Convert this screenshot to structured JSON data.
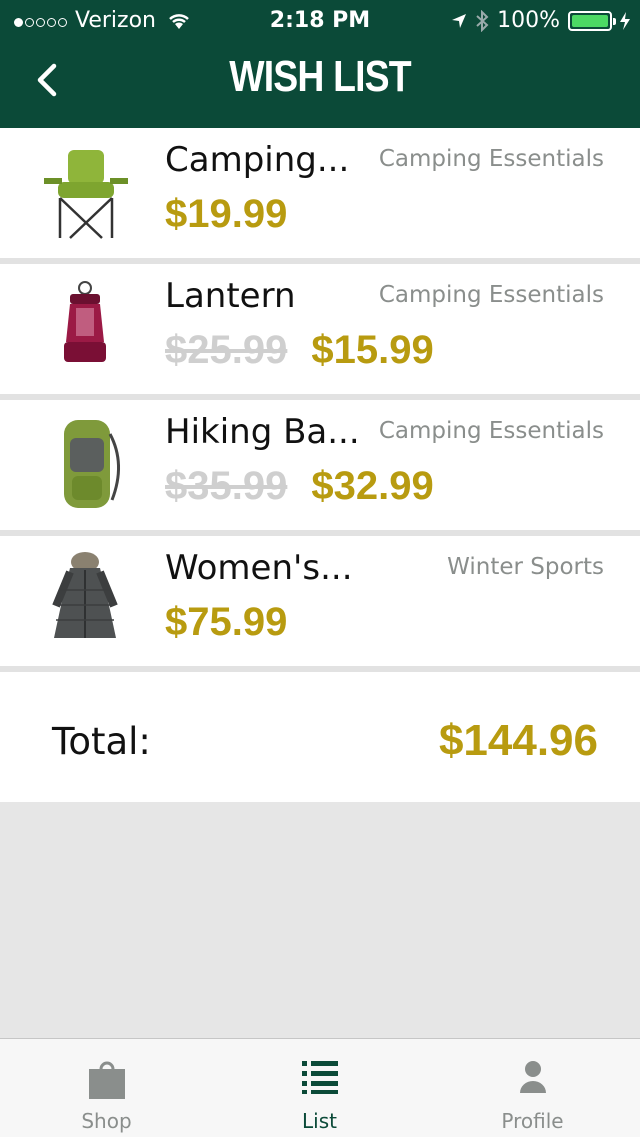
{
  "status_bar": {
    "carrier": "Verizon",
    "time": "2:18 PM",
    "battery": "100%"
  },
  "header": {
    "title": "WISH LIST"
  },
  "items": [
    {
      "name": "Camping...",
      "category": "Camping Essentials",
      "old_price": "",
      "price": "$19.99"
    },
    {
      "name": "Lantern",
      "category": "Camping Essentials",
      "old_price": "$25.99",
      "price": "$15.99"
    },
    {
      "name": "Hiking Ba...",
      "category": "Camping Essentials",
      "old_price": "$35.99",
      "price": "$32.99"
    },
    {
      "name": "Women's...",
      "category": "Winter Sports",
      "old_price": "",
      "price": "$75.99"
    }
  ],
  "total": {
    "label": "Total:",
    "value": "$144.96"
  },
  "tabs": [
    {
      "label": "Shop",
      "icon": "bag-icon"
    },
    {
      "label": "List",
      "icon": "list-icon"
    },
    {
      "label": "Profile",
      "icon": "person-icon"
    }
  ],
  "colors": {
    "header": "#0b4a38",
    "price": "#b89b10"
  }
}
